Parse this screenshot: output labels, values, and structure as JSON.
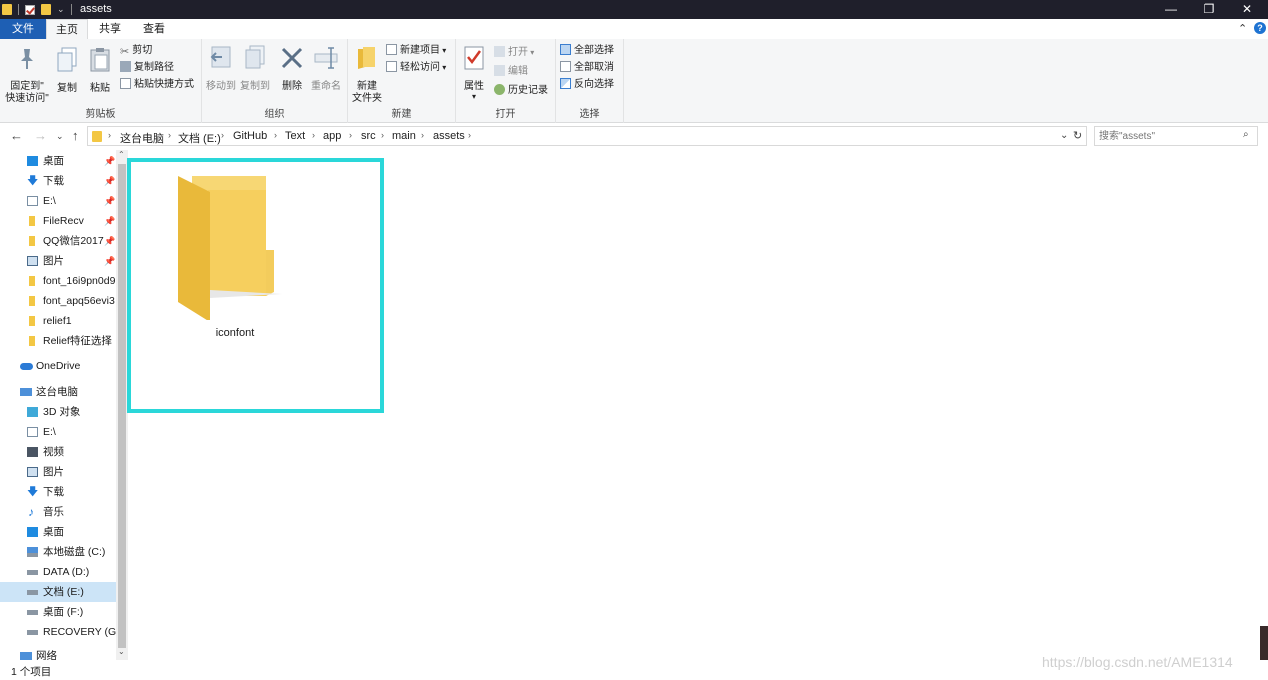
{
  "window": {
    "title": "assets"
  },
  "tabs": {
    "file": "文件",
    "home": "主页",
    "share": "共享",
    "view": "查看"
  },
  "ribbon": {
    "clipboard": {
      "label": "剪贴板",
      "pin": "固定到\"\n快速访问\"",
      "copy": "复制",
      "paste": "粘贴",
      "cut": "剪切",
      "copy_path": "复制路径",
      "paste_shortcut": "粘贴快捷方式"
    },
    "organize": {
      "label": "组织",
      "move_to": "移动到",
      "copy_to": "复制到",
      "delete": "删除",
      "rename": "重命名"
    },
    "new": {
      "label": "新建",
      "new_folder": "新建\n文件夹",
      "new_item": "新建项目",
      "easy_access": "轻松访问"
    },
    "open": {
      "label": "打开",
      "properties": "属性",
      "open": "打开",
      "edit": "编辑",
      "history": "历史记录"
    },
    "select": {
      "label": "选择",
      "select_all": "全部选择",
      "select_none": "全部取消",
      "invert": "反向选择"
    }
  },
  "address": {
    "crumbs": [
      "这台电脑",
      "文档 (E:)",
      "GitHub",
      "Text",
      "app",
      "src",
      "main",
      "assets"
    ],
    "search_placeholder": "搜索\"assets\""
  },
  "sidebar": {
    "quick_access": [
      {
        "label": "桌面",
        "pinned": true
      },
      {
        "label": "下载",
        "pinned": true
      },
      {
        "label": "E:\\",
        "pinned": true
      },
      {
        "label": "FileRecv",
        "pinned": true
      },
      {
        "label": "QQ微信2017",
        "pinned": true
      },
      {
        "label": "图片",
        "pinned": true
      },
      {
        "label": "font_16i9pn0d9",
        "pinned": false
      },
      {
        "label": "font_apq56evi3",
        "pinned": false
      },
      {
        "label": "relief1",
        "pinned": false
      },
      {
        "label": "Relief特征选择",
        "pinned": false
      }
    ],
    "onedrive": "OneDrive",
    "this_pc": "这台电脑",
    "pc_items": [
      {
        "label": "3D 对象"
      },
      {
        "label": "E:\\"
      },
      {
        "label": "视频"
      },
      {
        "label": "图片"
      },
      {
        "label": "下载"
      },
      {
        "label": "音乐"
      },
      {
        "label": "桌面"
      },
      {
        "label": "本地磁盘 (C:)"
      },
      {
        "label": "DATA (D:)"
      },
      {
        "label": "文档 (E:)"
      },
      {
        "label": "桌面 (F:)"
      },
      {
        "label": "RECOVERY (G:)"
      }
    ],
    "network": "网络"
  },
  "content": {
    "items": [
      {
        "name": "iconfont",
        "type": "folder"
      }
    ]
  },
  "status": {
    "count": "1 个项目"
  },
  "watermark": "https://blog.csdn.net/AME1314",
  "colors": {
    "accent": "#1e5fb4",
    "highlight": "#2ad7d9",
    "folder": "#f3c744",
    "selected": "#cce4f7"
  }
}
